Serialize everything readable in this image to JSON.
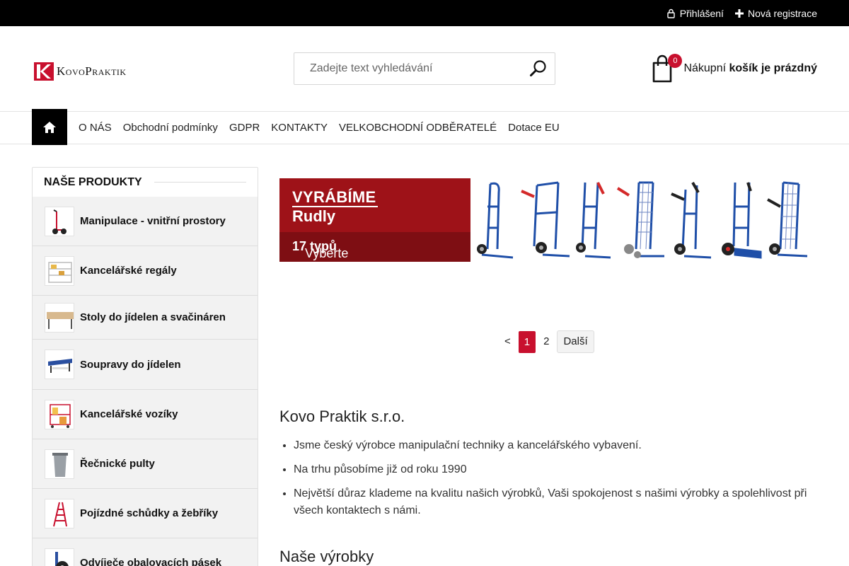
{
  "topbar": {
    "login_label": "Přihlášení",
    "register_label": "Nová registrace"
  },
  "header": {
    "logo_text": "KovoPraktik",
    "search_placeholder": "Zadejte text vyhledávání",
    "cart_count": "0",
    "cart_label_prefix": "Nákupní",
    "cart_label_bold": "košík je prázdný"
  },
  "nav": {
    "items": [
      "O NÁS",
      "Obchodní podmínky",
      "GDPR",
      "KONTAKTY",
      "VELKOBCHODNÍ ODBĚRATELÉ",
      "Dotace EU"
    ]
  },
  "sidebar": {
    "title": "NAŠE PRODUKTY",
    "items": [
      {
        "label": "Manipulace - vnitřní prostory",
        "icon": "hand-truck-icon"
      },
      {
        "label": "Kancelářské regály",
        "icon": "shelving-icon"
      },
      {
        "label": "Stoly do jídelen a svačináren",
        "icon": "table-icon"
      },
      {
        "label": "Soupravy do jídelen",
        "icon": "dining-set-icon"
      },
      {
        "label": "Kancelářské vozíky",
        "icon": "office-cart-icon"
      },
      {
        "label": "Řečnické pulty",
        "icon": "lectern-icon"
      },
      {
        "label": "Pojízdné schůdky a žebříky",
        "icon": "ladder-icon"
      },
      {
        "label": "Odvíječe obalovacích pásek",
        "icon": "tape-dispenser-icon"
      }
    ]
  },
  "banner": {
    "line1": "VYRÁBÍME",
    "line2": "Rudly",
    "line3_prefix": "Vyberte si ze ",
    "line3_bold": "17 typů"
  },
  "pagination": {
    "prev": "<",
    "pages": [
      "1",
      "2"
    ],
    "active": "1",
    "next": "Další"
  },
  "content": {
    "heading": "Kovo Praktik s.r.o.",
    "bullets": [
      "Jsme český výrobce manipulační techniky a kancelářského vybavení.",
      "Na trhu působíme již od roku 1990",
      "Největší důraz klademe na kvalitu našich výrobků, Vaši spokojenost s našimi výrobky a spolehlivost při všech kontaktech s námi."
    ],
    "subheading": "Naše výrobky"
  },
  "colors": {
    "accent": "#c8102e",
    "banner_red": "#9e1218",
    "topbar": "#000000",
    "truck_blue": "#1f4fa8"
  }
}
